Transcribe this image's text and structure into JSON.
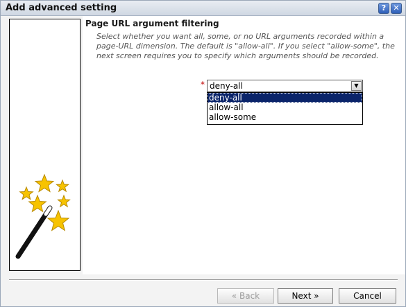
{
  "window": {
    "title": "Add advanced setting",
    "help_label": "?",
    "close_label": "✕"
  },
  "section": {
    "title": "Page URL argument filtering",
    "description": "Select whether you want all, some, or no URL arguments recorded within a page-URL dimension. The default is \"allow-all\". If you select \"allow-some\", the next screen requires you to specify which arguments should be recorded."
  },
  "filter_select": {
    "required_marker": "*",
    "value": "deny-all",
    "arrow": "▼",
    "options": [
      "deny-all",
      "allow-all",
      "allow-some"
    ],
    "highlighted_option": "deny-all"
  },
  "wizard_graphic": {
    "icon": "magic-wand-icon",
    "colors": {
      "star": "#f7c300",
      "star_outline": "#b88a00",
      "wand": "#111111",
      "wand_tip": "#ffffff"
    }
  },
  "buttons": {
    "back_label": "« Back",
    "next_label": "Next »",
    "cancel_label": "Cancel"
  }
}
